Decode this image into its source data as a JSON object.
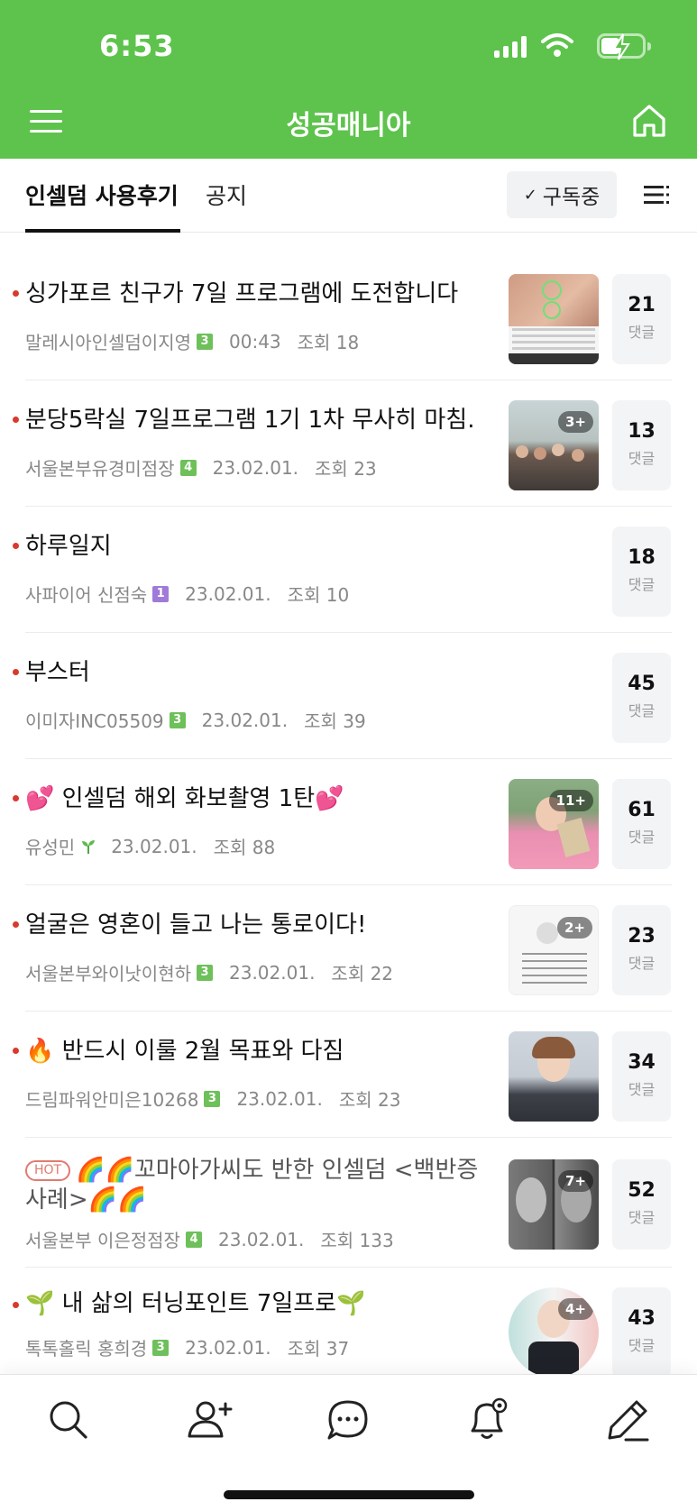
{
  "status_bar": {
    "time": "6:53"
  },
  "header": {
    "title": "성공매니아",
    "menu_icon": "hamburger-icon",
    "home_icon": "home-icon"
  },
  "tabs": [
    {
      "label": "인셀덤 사용후기",
      "active": true
    },
    {
      "label": "공지",
      "active": false
    }
  ],
  "subscribe": {
    "label": "구독중",
    "check": "✓"
  },
  "posts": [
    {
      "title": "싱가포르 친구가 7일 프로그램에 도전합니다",
      "author": "말레시아인셀덤이지영",
      "level": "3",
      "date": "00:43",
      "views": "조회 18",
      "comments": "21",
      "comment_label": "댓글",
      "thumb": true,
      "thumb_count": ""
    },
    {
      "title": "분당5락실 7일프로그램 1기 1차  무사히 마침.",
      "author": "서울본부유경미점장",
      "level": "4",
      "date": "23.02.01.",
      "views": "조회 23",
      "comments": "13",
      "comment_label": "댓글",
      "thumb": true,
      "thumb_count": "3+"
    },
    {
      "title": "하루일지",
      "author": "사파이어 신점숙",
      "level": "1",
      "date": "23.02.01.",
      "views": "조회 10",
      "comments": "18",
      "comment_label": "댓글",
      "thumb": false
    },
    {
      "title": "부스터",
      "author": "이미자INC05509",
      "level": "3",
      "date": "23.02.01.",
      "views": "조회 39",
      "comments": "45",
      "comment_label": "댓글",
      "thumb": false
    },
    {
      "title": "💕 인셀덤 해외 화보촬영 1탄💕",
      "author": "유성민",
      "level": "",
      "date": "23.02.01.",
      "views": "조회 88",
      "comments": "61",
      "comment_label": "댓글",
      "thumb": true,
      "thumb_count": "11+"
    },
    {
      "title": "얼굴은 영혼이 들고 나는 통로이다!",
      "author": "서울본부와이낫이현하",
      "level": "3",
      "date": "23.02.01.",
      "views": "조회 22",
      "comments": "23",
      "comment_label": "댓글",
      "thumb": true,
      "thumb_count": "2+"
    },
    {
      "title": "🔥 반드시 이룰 2월 목표와 다짐",
      "author": "드림파워안미은10268",
      "level": "3",
      "date": "23.02.01.",
      "views": "조회 23",
      "comments": "34",
      "comment_label": "댓글",
      "thumb": true,
      "thumb_count": ""
    },
    {
      "hot_label": "HOT",
      "title": "🌈🌈꼬마아가씨도 반한 인셀덤 <백반증사례>🌈🌈",
      "author": "서울본부 이은정점장",
      "level": "4",
      "date": "23.02.01.",
      "views": "조회 133",
      "comments": "52",
      "comment_label": "댓글",
      "thumb": true,
      "thumb_count": "7+"
    },
    {
      "title": "🌱 내 삶의 터닝포인트 7일프로🌱",
      "author": "톡톡홀릭 홍희경",
      "level": "3",
      "date": "23.02.01.",
      "views": "조회 37",
      "comments": "43",
      "comment_label": "댓글",
      "thumb": true,
      "thumb_count": "4+"
    }
  ],
  "bottom_nav": [
    {
      "icon": "search-icon"
    },
    {
      "icon": "add-friend-icon"
    },
    {
      "icon": "chat-icon"
    },
    {
      "icon": "notification-settings-icon"
    },
    {
      "icon": "write-icon"
    }
  ],
  "colors": {
    "brand_green": "#5dc34c",
    "unread_dot": "#d83a2e",
    "level_green": "#6ec05a",
    "level_purple": "#a07ad8",
    "hot_red": "#e27a6f"
  }
}
